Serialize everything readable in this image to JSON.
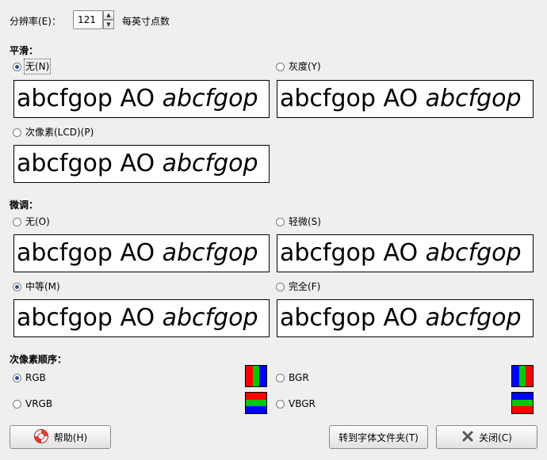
{
  "resolution": {
    "label": "分辨率(E)：",
    "value": "121",
    "unit": "每英寸点数"
  },
  "smoothing": {
    "heading": "平滑：",
    "options": [
      {
        "label": "无(N)",
        "selected": true
      },
      {
        "label": "灰度(Y)",
        "selected": false
      },
      {
        "label": "次像素(LCD)(P)",
        "selected": false
      }
    ]
  },
  "hinting": {
    "heading": "微调：",
    "options": [
      {
        "label": "无(O)",
        "selected": false
      },
      {
        "label": "轻微(S)",
        "selected": false
      },
      {
        "label": "中等(M)",
        "selected": true
      },
      {
        "label": "完全(F)",
        "selected": false
      }
    ]
  },
  "preview": {
    "regular": "abcfgop AO ",
    "italic": "abcfgop"
  },
  "subpixel": {
    "heading": "次像素顺序：",
    "options": [
      {
        "label": "RGB",
        "selected": true,
        "colors": [
          "#ff0000",
          "#00c800",
          "#0000ff"
        ]
      },
      {
        "label": "BGR",
        "selected": false,
        "colors": [
          "#0000ff",
          "#00c800",
          "#ff0000"
        ]
      },
      {
        "label": "VRGB",
        "selected": false,
        "colors": [
          "#ff0000",
          "#00c800",
          "#0000ff"
        ]
      },
      {
        "label": "VBGR",
        "selected": false,
        "colors": [
          "#0000ff",
          "#00c800",
          "#ff0000"
        ]
      }
    ]
  },
  "buttons": {
    "help": "帮助(H)",
    "goto_folder": "转到字体文件夹(T)",
    "close": "关闭(C)"
  },
  "icons": {
    "help": "lifebuoy-icon",
    "close": "close-x-icon"
  }
}
